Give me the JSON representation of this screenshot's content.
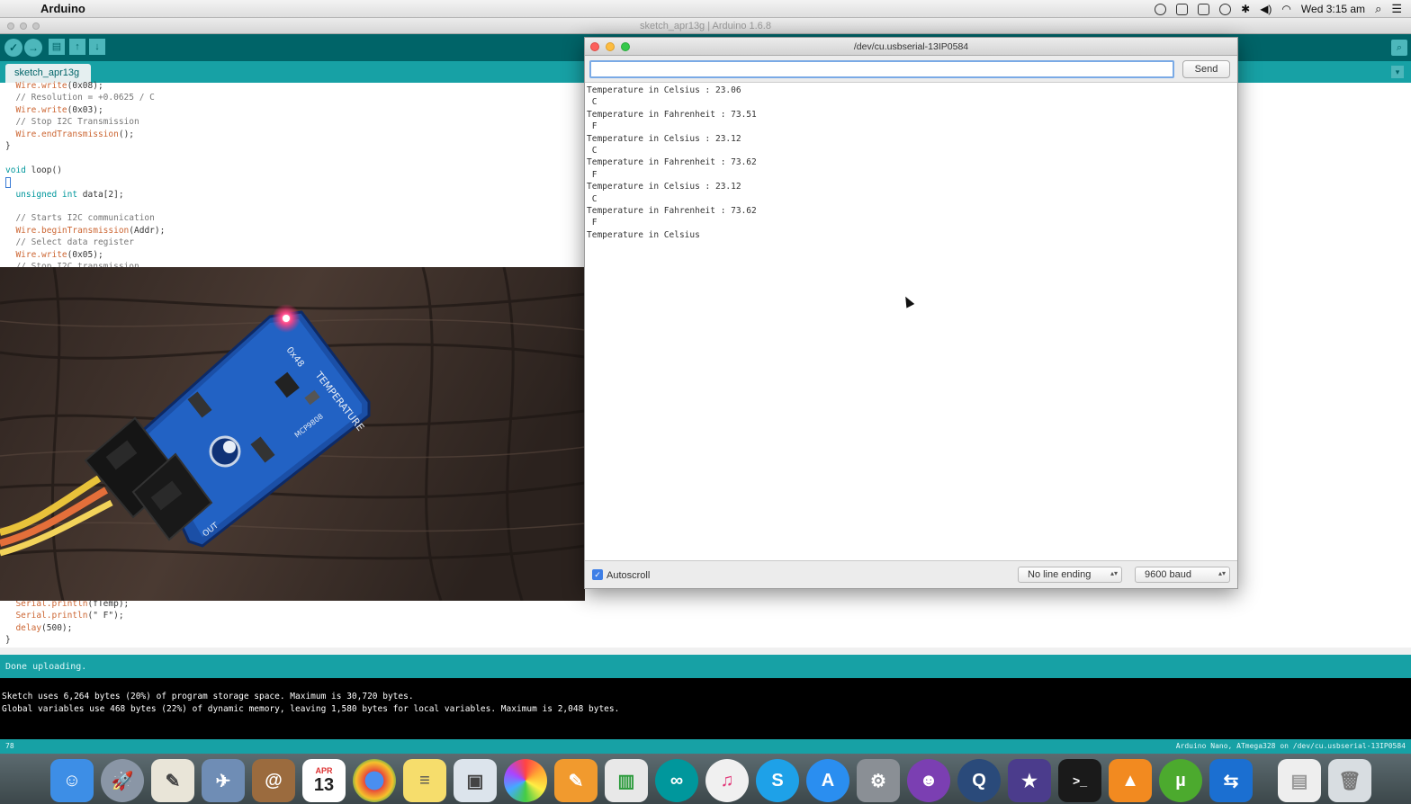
{
  "menubar": {
    "app_name": "Arduino",
    "clock": "Wed 3:15 am"
  },
  "window": {
    "title": "sketch_apr13g | Arduino 1.6.8"
  },
  "toolbar": {
    "verify": "✓",
    "upload": "→",
    "new": "▤",
    "open": "↑",
    "save": "↓",
    "serial_monitor": "⌕"
  },
  "tab": {
    "label": "sketch_apr13g"
  },
  "code_top": [
    {
      "kw": "  Wire.write",
      "rest": "(0x08);"
    },
    {
      "cm": "  // Resolution = +0.0625 / C"
    },
    {
      "kw": "  Wire.write",
      "rest": "(0x03);"
    },
    {
      "cm": "  // Stop I2C Transmission"
    },
    {
      "kw": "  Wire.endTransmission",
      "rest": "();"
    },
    {
      "plain": "}"
    },
    {
      "plain": ""
    },
    {
      "ty": "void ",
      "plain2": "loop()"
    },
    {
      "cursor": true
    },
    {
      "ty": "  unsigned int ",
      "plain2": "data[2];"
    },
    {
      "plain": ""
    },
    {
      "cm": "  // Starts I2C communication"
    },
    {
      "kw": "  Wire.beginTransmission",
      "rest": "(Addr);"
    },
    {
      "cm": "  // Select data register"
    },
    {
      "kw": "  Wire.write",
      "rest": "(0x05);"
    },
    {
      "cm": "  // Stop I2C transmission"
    }
  ],
  "code_bottom": [
    {
      "kw": "  Serial.println",
      "rest": "(fTemp);"
    },
    {
      "kw": "  Serial.println",
      "rest": "(\" F\");"
    },
    {
      "kw": "  delay",
      "rest": "(500);"
    },
    {
      "plain": "}"
    }
  ],
  "status": {
    "message": "Done uploading."
  },
  "console": {
    "line1": "Sketch uses 6,264 bytes (20%) of program storage space. Maximum is 30,720 bytes.",
    "line2": "Global variables use 468 bytes (22%) of dynamic memory, leaving 1,580 bytes for local variables. Maximum is 2,048 bytes."
  },
  "footer": {
    "line_number": "78",
    "board": "Arduino Nano, ATmega328 on /dev/cu.usbserial-13IP0584"
  },
  "serial_monitor": {
    "title": "/dev/cu.usbserial-13IP0584",
    "input_value": "",
    "send_label": "Send",
    "output": [
      "Temperature in Celsius : 23.06",
      " C",
      "Temperature in Fahrenheit : 73.51",
      " F",
      "Temperature in Celsius : 23.12",
      " C",
      "Temperature in Fahrenheit : 73.62",
      " F",
      "Temperature in Celsius : 23.12",
      " C",
      "Temperature in Fahrenheit : 73.62",
      " F",
      "Temperature in Celsius"
    ],
    "autoscroll_label": "Autoscroll",
    "autoscroll_checked": true,
    "line_ending": "No line ending",
    "baud": "9600 baud"
  },
  "photo": {
    "board_text": "TEMPERATURE",
    "board_addr": "0x48",
    "board_part": "MCP9808",
    "connector_label": "OUT"
  },
  "dock": {
    "calendar_month": "APR",
    "calendar_day": "13",
    "items": [
      "finder",
      "launchpad",
      "textedit",
      "preview",
      "contacts",
      "calendar",
      "chrome",
      "notes",
      "photo-booth",
      "photos",
      "pages",
      "numbers",
      "arduino",
      "itunes",
      "skype",
      "app-store",
      "system-preferences",
      "github",
      "quicktime",
      "imovie",
      "terminal",
      "vlc",
      "utorrent",
      "teamviewer",
      "documents",
      "trash"
    ]
  }
}
